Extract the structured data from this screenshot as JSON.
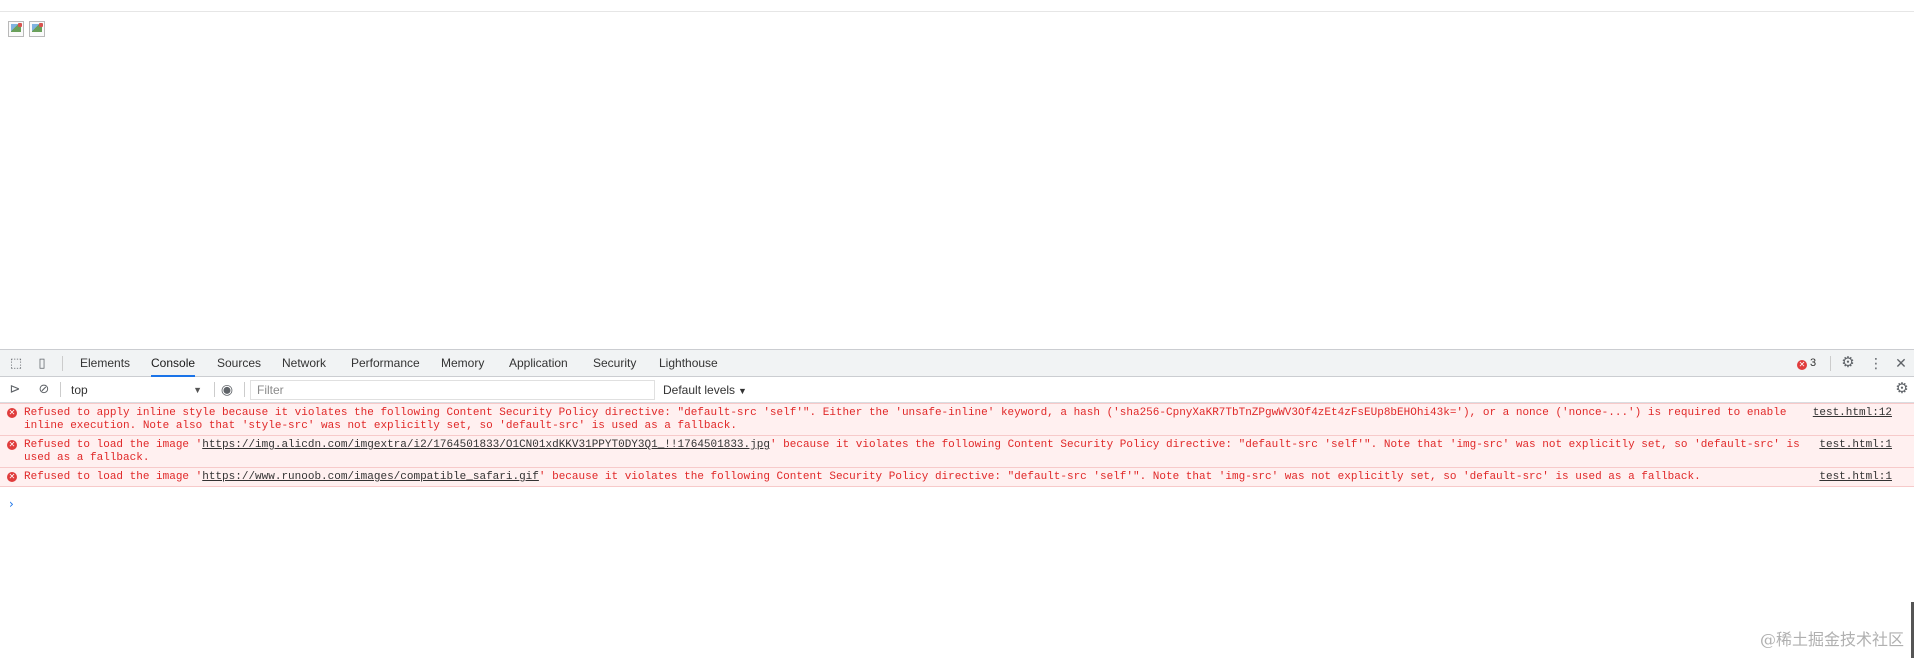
{
  "devtools": {
    "tabs": [
      "Elements",
      "Console",
      "Sources",
      "Network",
      "Performance",
      "Memory",
      "Application",
      "Security",
      "Lighthouse"
    ],
    "active_tab": "Console",
    "error_count": "3",
    "context": "top",
    "filter_placeholder": "Filter",
    "levels": "Default levels"
  },
  "messages": [
    {
      "text": "Refused to apply inline style because it violates the following Content Security Policy directive: \"default-src 'self'\". Either the 'unsafe-inline' keyword, a hash ('sha256-CpnyXaKR7TbTnZPgwWV3Of4zEt4zFsEUp8bEHOhi43k='), or a nonce ('nonce-...') is required to enable inline execution. Note also that 'style-src' was not explicitly set, so 'default-src' is used as a fallback.",
      "source": "test.html:12"
    },
    {
      "prefix": "Refused to load the image '",
      "link": "https://img.alicdn.com/imgextra/i2/1764501833/O1CN01xdKKV31PPYT0DY3Q1_!!1764501833.jpg",
      "suffix": "' because it violates the following Content Security Policy directive: \"default-src 'self'\". Note that 'img-src' was not explicitly set, so 'default-src' is used as a fallback.",
      "source": "test.html:1"
    },
    {
      "prefix": "Refused to load the image '",
      "link": "https://www.runoob.com/images/compatible_safari.gif",
      "suffix": "' because it violates the following Content Security Policy directive: \"default-src 'self'\". Note that 'img-src' was not explicitly set, so 'default-src' is used as a fallback.",
      "source": "test.html:1"
    }
  ],
  "prompt_symbol": "›",
  "watermark": "@稀土掘金技术社区"
}
